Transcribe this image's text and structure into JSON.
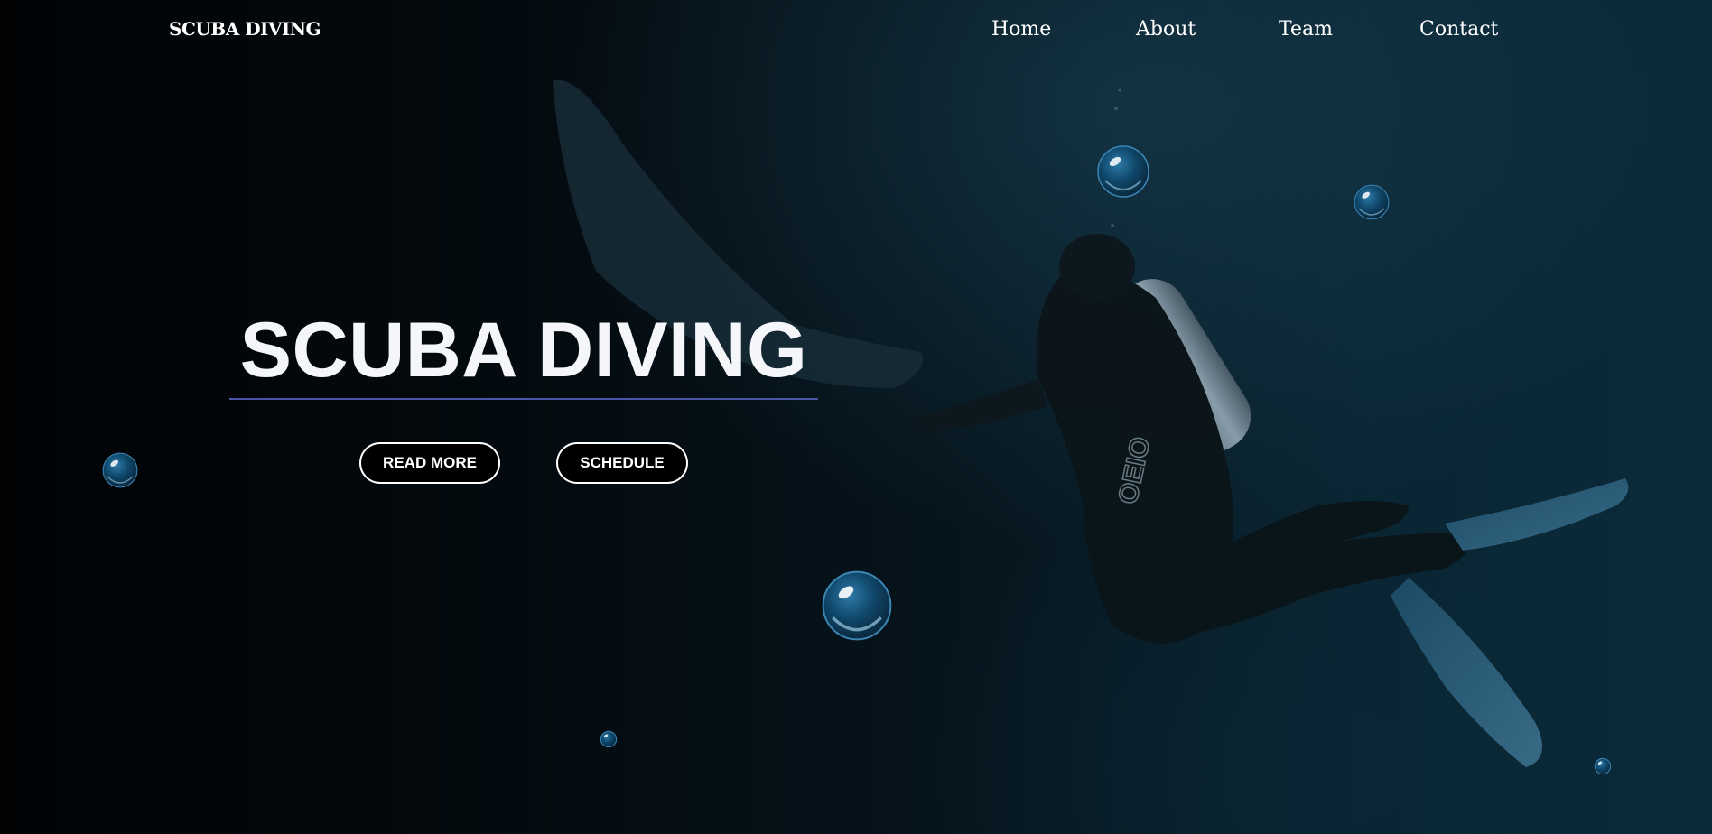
{
  "nav": {
    "brand": "SCUBA DIVING",
    "items": [
      {
        "label": "Home"
      },
      {
        "label": "About"
      },
      {
        "label": "Team"
      },
      {
        "label": "Contact"
      }
    ]
  },
  "hero": {
    "title": "SCUBA DIVING",
    "buttons": {
      "read_more": "READ MORE",
      "schedule": "SCHEDULE"
    }
  },
  "colors": {
    "background_dark": "#020608",
    "background_ocean": "#0b2a3a",
    "title_rule": "#4a55a8",
    "text": "#ffffff",
    "bubble": "#1a5a80"
  },
  "icons": {
    "bubble": "bubble-icon"
  }
}
